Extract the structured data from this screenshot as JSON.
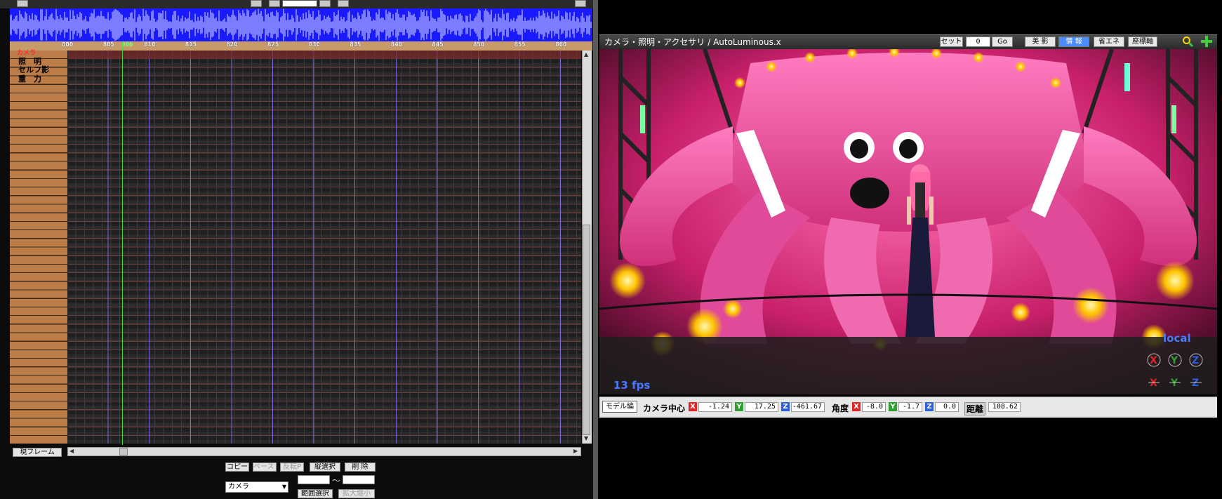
{
  "timeline": {
    "frame_ticks": [
      "800",
      "805",
      "810",
      "815",
      "820",
      "825",
      "830",
      "835",
      "840",
      "845",
      "850",
      "855",
      "860"
    ],
    "current_frame": "806",
    "track_labels": [
      "カメラ",
      "照　明",
      "セルフ影",
      "重　力"
    ],
    "current_frame_button": "現フレーム",
    "edit_buttons": {
      "copy": "コピー",
      "paste": "ペースト",
      "reverse_paste": "反転P",
      "vertical_select": "縦選択",
      "delete": "削 除",
      "range_select": "範囲選択",
      "scale": "拡大縮小"
    },
    "range_separator": "～",
    "target_select": "カメラ"
  },
  "viewport": {
    "title": "カメラ・照明・アクセサリ / AutoLuminous.x",
    "set_label": "セット",
    "set_value": "0",
    "go_label": "Go",
    "view_buttons": [
      "美 影",
      "情 報",
      "省エネ",
      "座標軸"
    ],
    "active_view_button": "情 報",
    "fps_text": "13 fps",
    "local_text": "local",
    "model_edit_button": "モデル編",
    "camera_center_label": "カメラ中心",
    "camera_center": {
      "x": "-1.24",
      "y": "17.25",
      "z": "-461.67"
    },
    "angle_label": "角度",
    "angle": {
      "x": "-8.0",
      "y": "-1.7",
      "z": "0.0"
    },
    "distance_label": "距離",
    "distance": "108.62"
  },
  "icons": [
    "search-icon",
    "plus-icon",
    "rotate-axis-icons"
  ],
  "colors": {
    "waveform": "#1a1aff",
    "cursor": "#46d846",
    "accent_blue": "#4a8cff",
    "scene_pink": "#e8338c"
  }
}
